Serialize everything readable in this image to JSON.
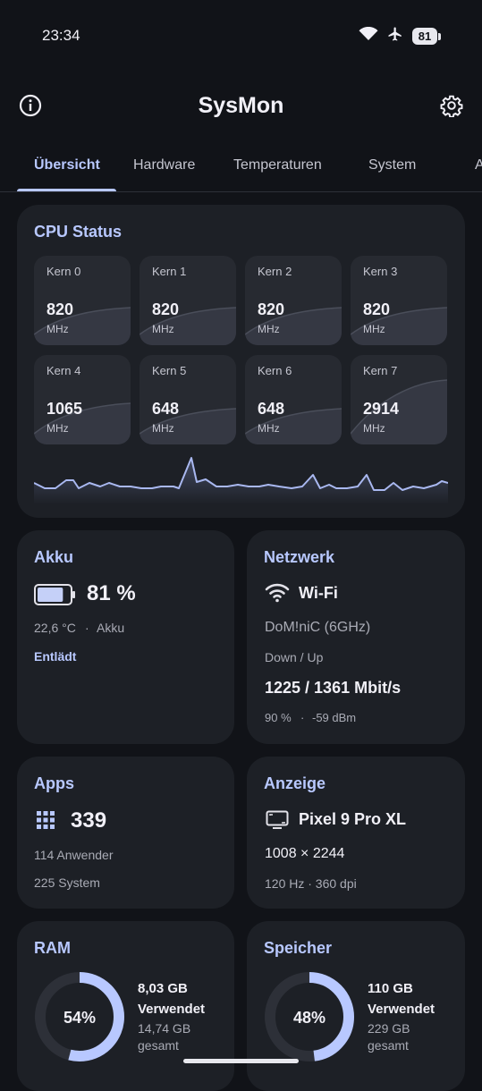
{
  "status_bar": {
    "time": "23:34",
    "battery": "81"
  },
  "app_bar": {
    "title": "SysMon"
  },
  "tabs": [
    {
      "label": "Übersicht",
      "active": true
    },
    {
      "label": "Hardware"
    },
    {
      "label": "Temperaturen"
    },
    {
      "label": "System"
    },
    {
      "label": "A"
    }
  ],
  "cpu": {
    "title": "CPU Status",
    "unit": "MHz",
    "cores": [
      {
        "name": "Kern 0",
        "value": "820"
      },
      {
        "name": "Kern 1",
        "value": "820"
      },
      {
        "name": "Kern 2",
        "value": "820"
      },
      {
        "name": "Kern 3",
        "value": "820"
      },
      {
        "name": "Kern 4",
        "value": "1065"
      },
      {
        "name": "Kern 5",
        "value": "648"
      },
      {
        "name": "Kern 6",
        "value": "648"
      },
      {
        "name": "Kern 7",
        "value": "2914"
      }
    ]
  },
  "battery": {
    "title": "Akku",
    "percent": "81 %",
    "level": 0.81,
    "temp": "22,6 °C",
    "source": "Akku",
    "state": "Entlädt"
  },
  "network": {
    "title": "Netzwerk",
    "type": "Wi-Fi",
    "ssid": "DoM!niC (6GHz)",
    "speed_label": "Down / Up",
    "speed": "1225 / 1361 Mbit/s",
    "quality": "90 %",
    "signal": "-59 dBm"
  },
  "apps": {
    "title": "Apps",
    "count": "339",
    "user": "114 Anwender",
    "system": "225 System"
  },
  "display": {
    "title": "Anzeige",
    "device": "Pixel 9 Pro XL",
    "resolution": "1008 × 2244",
    "details": "120 Hz · 360 dpi"
  },
  "ram": {
    "title": "RAM",
    "percent": "54%",
    "fraction": 0.54,
    "used": "8,03 GB",
    "used_label": "Verwendet",
    "total": "14,74 GB",
    "total_label": "gesamt"
  },
  "storage": {
    "title": "Speicher",
    "percent": "48%",
    "fraction": 0.48,
    "used": "110 GB",
    "used_label": "Verwendet",
    "total": "229 GB",
    "total_label": "gesamt"
  },
  "colors": {
    "accent": "#b8c8ff",
    "card": "#1d2026",
    "background": "#111318"
  }
}
